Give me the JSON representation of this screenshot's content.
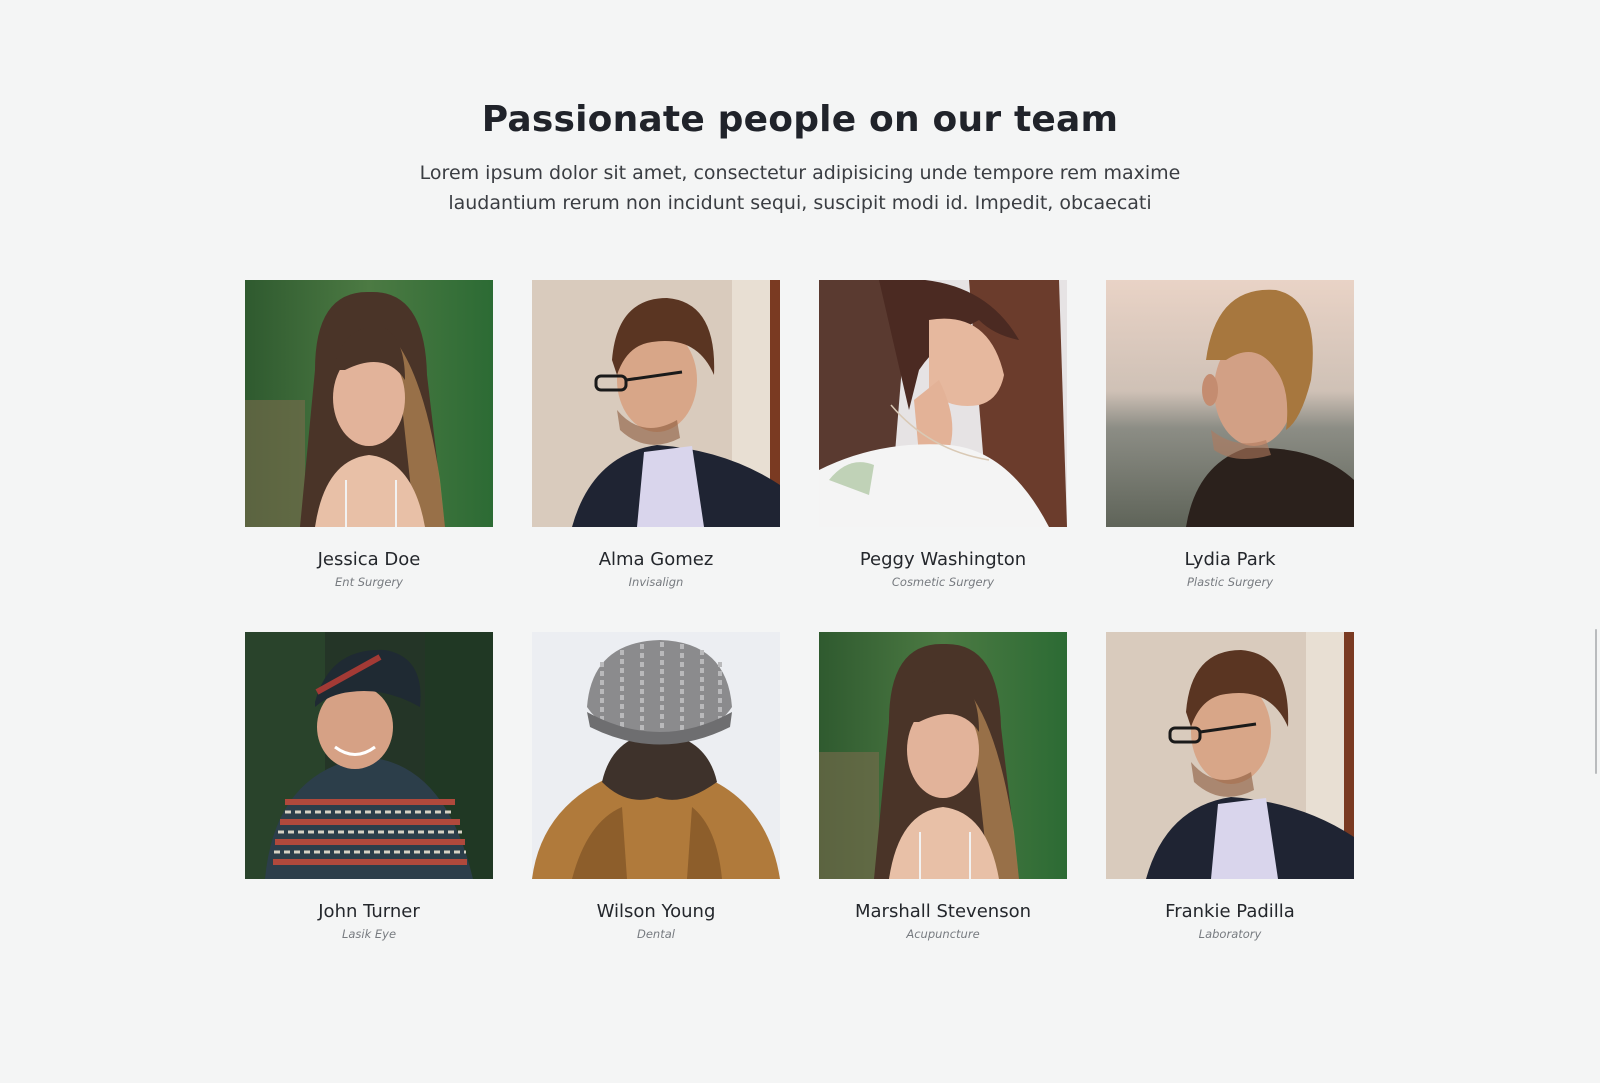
{
  "header": {
    "title": "Passionate people on our team",
    "lead": "Lorem ipsum dolor sit amet, consectetur adipisicing unde tempore rem maxime laudantium rerum non incidunt sequi, suscipit modi id. Impedit, obcaecati"
  },
  "team": [
    {
      "name": "Jessica Doe",
      "role": "Ent Surgery",
      "icon": "photo-woman-forest"
    },
    {
      "name": "Alma Gomez",
      "role": "Invisalign",
      "icon": "photo-man-glasses"
    },
    {
      "name": "Peggy Washington",
      "role": "Cosmetic Surgery",
      "icon": "photo-woman-profile"
    },
    {
      "name": "Lydia Park",
      "role": "Plastic Surgery",
      "icon": "photo-man-back"
    },
    {
      "name": "John Turner",
      "role": "Lasik Eye",
      "icon": "photo-man-beanie"
    },
    {
      "name": "Wilson Young",
      "role": "Dental",
      "icon": "photo-knit-hat"
    },
    {
      "name": "Marshall Stevenson",
      "role": "Acupuncture",
      "icon": "photo-woman-forest"
    },
    {
      "name": "Frankie Padilla",
      "role": "Laboratory",
      "icon": "photo-man-glasses"
    }
  ],
  "colors": {
    "background": "#f4f5f5",
    "heading": "#20232a",
    "role_text": "#777b80"
  }
}
